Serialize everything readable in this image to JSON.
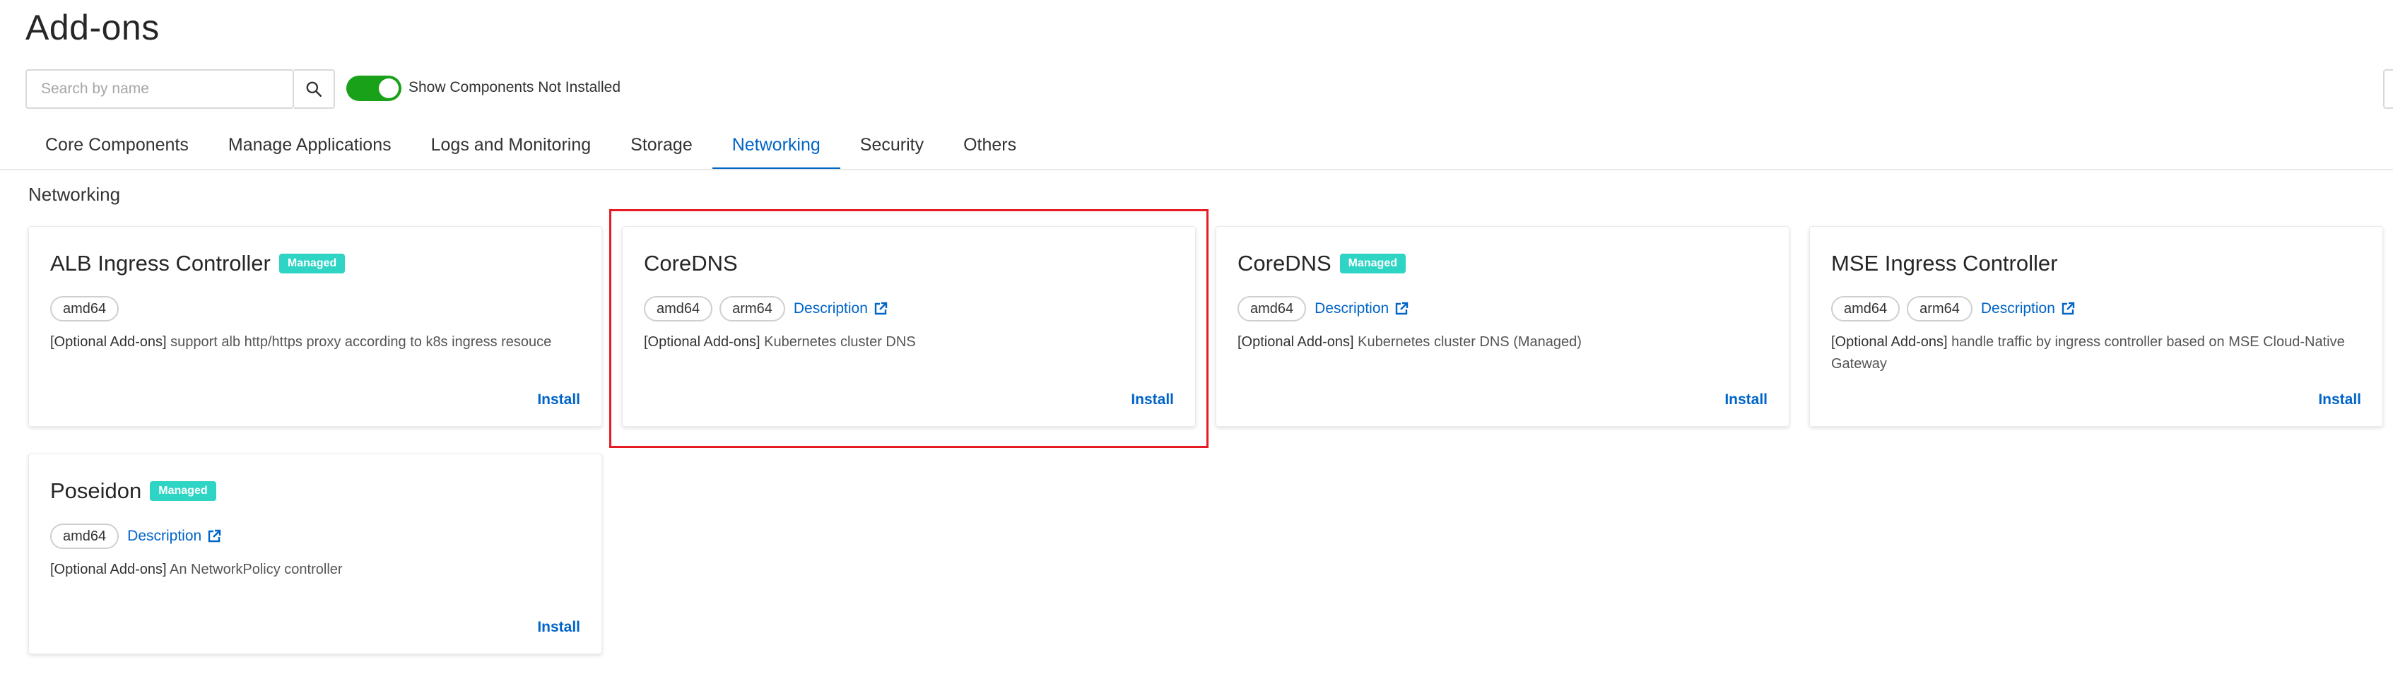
{
  "page": {
    "title": "Add-ons"
  },
  "search": {
    "placeholder": "Search by name",
    "value": ""
  },
  "toggle": {
    "label": "Show Components Not Installed",
    "on": true
  },
  "tabs": [
    {
      "label": "Core Components",
      "active": false
    },
    {
      "label": "Manage Applications",
      "active": false
    },
    {
      "label": "Logs and Monitoring",
      "active": false
    },
    {
      "label": "Storage",
      "active": false
    },
    {
      "label": "Networking",
      "active": true
    },
    {
      "label": "Security",
      "active": false
    },
    {
      "label": "Others",
      "active": false
    }
  ],
  "section": {
    "title": "Networking"
  },
  "colors": {
    "accent": "#0064c8",
    "badge": "#2ed4c4",
    "toggle": "#1aa11a",
    "highlight": "#e51c23"
  },
  "cards": [
    {
      "name": "ALB Ingress Controller",
      "badge": "Managed",
      "tags": [
        "amd64"
      ],
      "description_link": "",
      "desc_prefix": "[Optional Add-ons]",
      "desc_text": " support alb http/https proxy according to k8s ingress resouce",
      "action": "Install"
    },
    {
      "name": "CoreDNS",
      "badge": "",
      "tags": [
        "amd64",
        "arm64"
      ],
      "description_link": "Description",
      "desc_prefix": "[Optional Add-ons]",
      "desc_text": " Kubernetes cluster DNS",
      "action": "Install"
    },
    {
      "name": "CoreDNS",
      "badge": "Managed",
      "tags": [
        "amd64"
      ],
      "description_link": "Description",
      "desc_prefix": "[Optional Add-ons]",
      "desc_text": " Kubernetes cluster DNS (Managed)",
      "action": "Install"
    },
    {
      "name": "MSE Ingress Controller",
      "badge": "",
      "tags": [
        "amd64",
        "arm64"
      ],
      "description_link": "Description",
      "desc_prefix": "[Optional Add-ons]",
      "desc_text": " handle traffic by ingress controller based on MSE Cloud-Native Gateway",
      "action": "Install"
    },
    {
      "name": "Poseidon",
      "badge": "Managed",
      "tags": [
        "amd64"
      ],
      "description_link": "Description",
      "desc_prefix": "[Optional Add-ons]",
      "desc_text": " An NetworkPolicy controller",
      "action": "Install"
    }
  ]
}
